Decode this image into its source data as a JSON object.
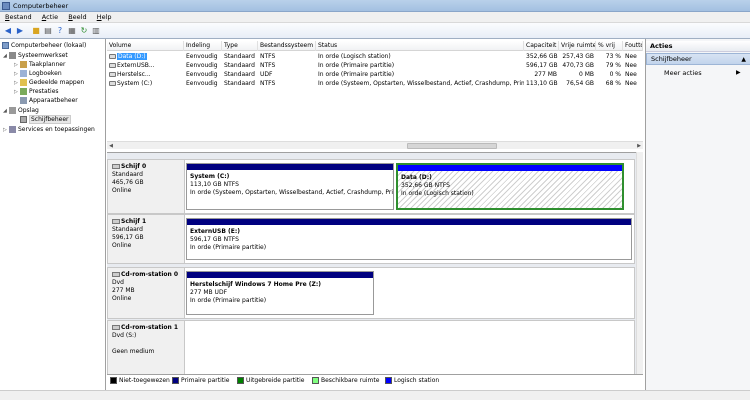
{
  "window": {
    "title": "Computerbeheer"
  },
  "menu": [
    {
      "accel": "B",
      "rest": "estand"
    },
    {
      "accel": "A",
      "rest": "ctie"
    },
    {
      "accel": "B",
      "rest": "eeld"
    },
    {
      "accel": "H",
      "rest": "elp"
    }
  ],
  "toolbar": [
    "back-icon",
    "forward-icon",
    "up-icon",
    "properties-icon",
    "help-icon",
    "show-hide-icon",
    "refresh-icon",
    "export-icon"
  ],
  "tree": {
    "root": "Computerbeheer (lokaal)",
    "items": [
      {
        "label": "Systeemwerkset",
        "level": 1,
        "expand": "◢"
      },
      {
        "label": "Taakplanner",
        "level": 2,
        "expand": "▷"
      },
      {
        "label": "Logboeken",
        "level": 2,
        "expand": "▷"
      },
      {
        "label": "Gedeelde mappen",
        "level": 2,
        "expand": "▷"
      },
      {
        "label": "Prestaties",
        "level": 2,
        "expand": "▷"
      },
      {
        "label": "Apparaatbeheer",
        "level": 2,
        "expand": ""
      },
      {
        "label": "Opslag",
        "level": 1,
        "expand": "◢"
      },
      {
        "label": "Schijfbeheer",
        "level": 2,
        "expand": "",
        "selected": true
      },
      {
        "label": "Services en toepassingen",
        "level": 1,
        "expand": "▷"
      }
    ]
  },
  "volumes": {
    "headers": [
      "Volume",
      "Indeling",
      "Type",
      "Bestandssysteem",
      "Status",
      "Capaciteit",
      "Vrije ruimte",
      "% vrij",
      "Foutto"
    ],
    "rows": [
      [
        "Data (D:)",
        "Eenvoudig",
        "Standaard",
        "NTFS",
        "In orde (Logisch station)",
        "352,66 GB",
        "257,43 GB",
        "73 %",
        "Nee"
      ],
      [
        "ExternUSB...",
        "Eenvoudig",
        "Standaard",
        "NTFS",
        "In orde (Primaire partitie)",
        "596,17 GB",
        "470,73 GB",
        "79 %",
        "Nee"
      ],
      [
        "Herstelsc...",
        "Eenvoudig",
        "Standaard",
        "UDF",
        "In orde (Primaire partitie)",
        "277 MB",
        "0 MB",
        "0 %",
        "Nee"
      ],
      [
        "System (C:)",
        "Eenvoudig",
        "Standaard",
        "NTFS",
        "In orde (Systeem, Opstarten, Wisselbestand, Actief, Crashdump, Primaire partitie)",
        "113,10 GB",
        "76,54 GB",
        "68 %",
        "Nee"
      ]
    ]
  },
  "disks": [
    {
      "name": "Schijf 0",
      "type": "Standaard",
      "size": "465,76 GB",
      "state": "Online",
      "partitions": [
        {
          "title": "System  (C:)",
          "line1": "113,10 GB NTFS",
          "line2": "In orde (Systeem, Opstarten, Wisselbestand, Actief, Crashdump, Prima",
          "kind": "primary"
        },
        {
          "title": "Data  (D:)",
          "line1": "352,66 GB NTFS",
          "line2": "In orde (Logisch station)",
          "kind": "logical"
        }
      ]
    },
    {
      "name": "Schijf 1",
      "type": "Standaard",
      "size": "596,17 GB",
      "state": "Online",
      "partitions": [
        {
          "title": "ExternUSB  (E:)",
          "line1": "596,17 GB NTFS",
          "line2": "In orde (Primaire partitie)",
          "kind": "primary"
        }
      ]
    },
    {
      "name": "Cd-rom-station 0",
      "type": "Dvd",
      "size": "277 MB",
      "state": "Online",
      "partitions": [
        {
          "title": "Herstelschijf Windows 7 Home Pre  (Z:)",
          "line1": "277 MB UDF",
          "line2": "In orde (Primaire partitie)",
          "kind": "primary"
        }
      ]
    },
    {
      "name": "Cd-rom-station 1",
      "type": "Dvd (S:)",
      "size": "",
      "state": "Geen medium",
      "partitions": []
    }
  ],
  "legend": [
    {
      "label": "Niet-toegewezen",
      "color": "#000000"
    },
    {
      "label": "Primaire partitie",
      "color": "#000080"
    },
    {
      "label": "Uitgebreide partitie",
      "color": "#008000"
    },
    {
      "label": "Beschikbare ruimte",
      "color": "#80ff80"
    },
    {
      "label": "Logisch station",
      "color": "#0000ff"
    }
  ],
  "actions": {
    "header": "Acties",
    "section": "Schijfbeheer",
    "more": "Meer acties"
  },
  "colors": {
    "primary": "#000080",
    "logical": "#0000ff",
    "selected_border": "#2f8f2f"
  }
}
